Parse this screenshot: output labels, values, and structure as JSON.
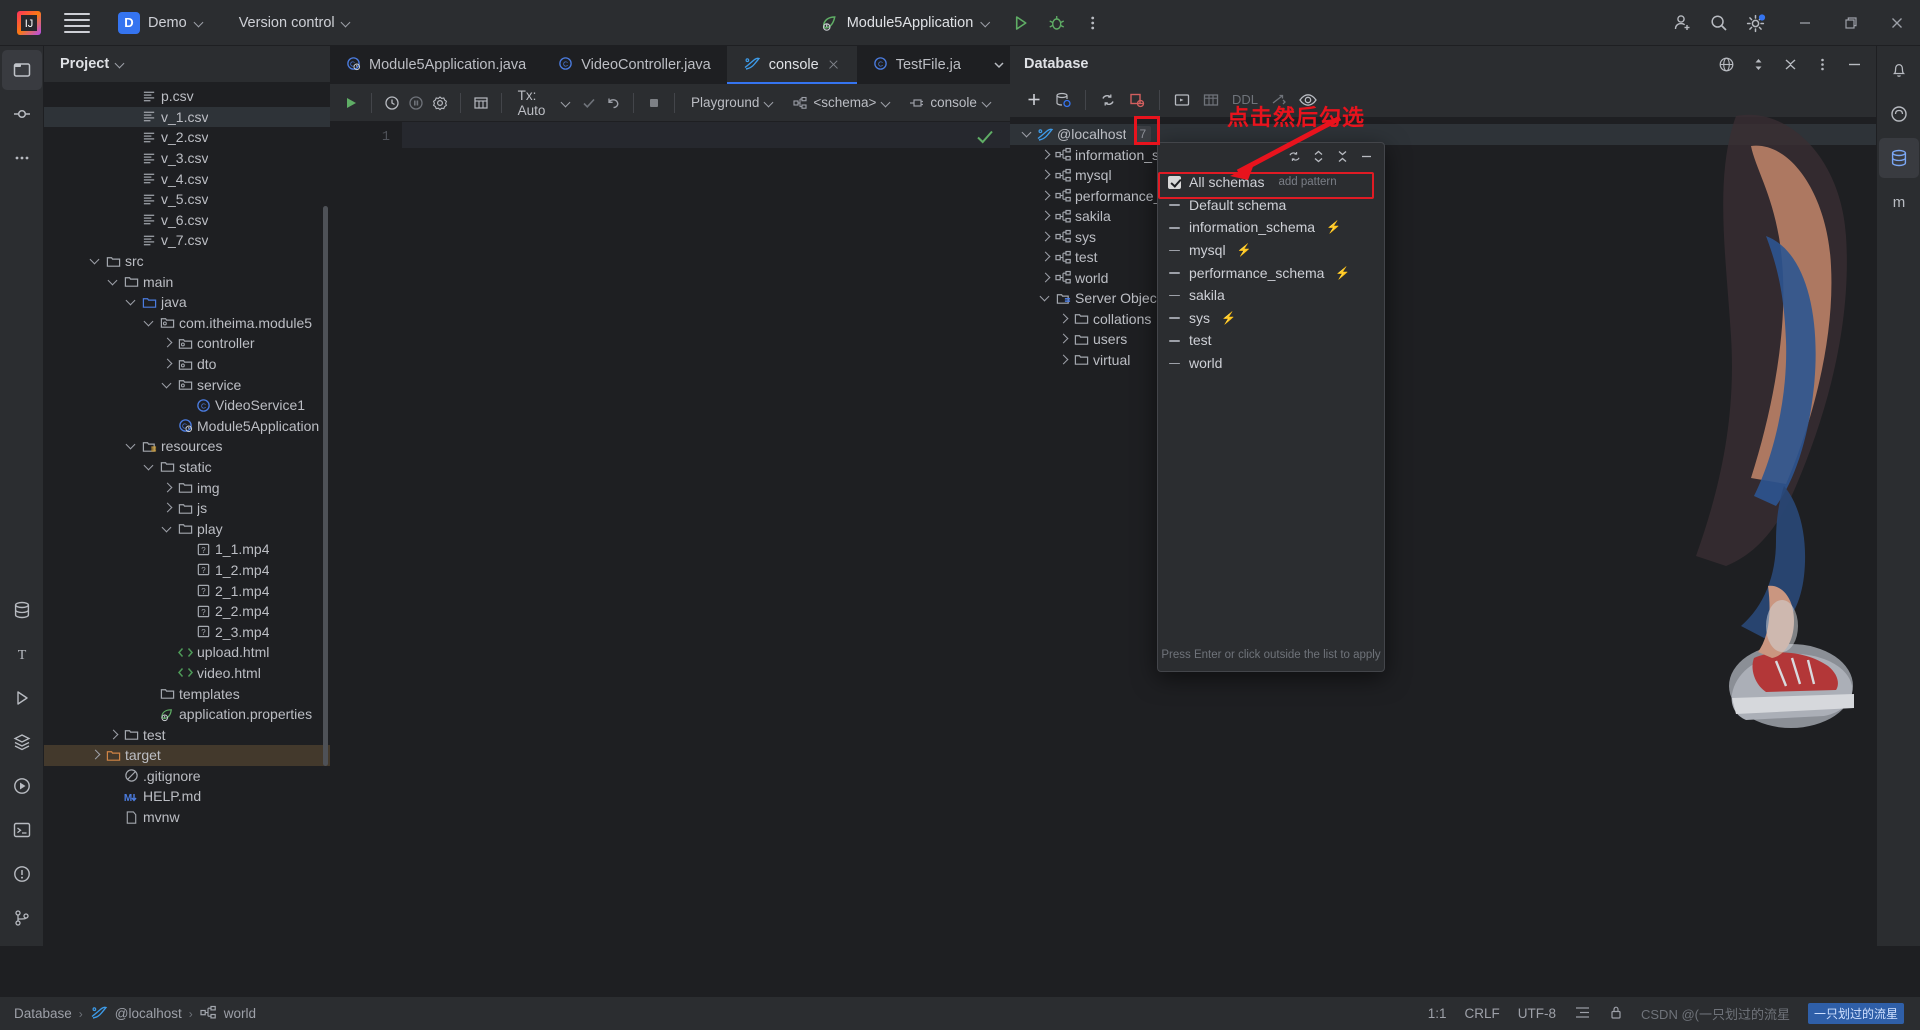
{
  "titlebar": {
    "project_name": "Demo",
    "vcs_label": "Version control",
    "run_config": "Module5Application",
    "icons": {
      "menu": "hamburger-icon",
      "run": "run-icon",
      "debug": "debug-icon",
      "more": "more-vertical-icon",
      "account": "account-icon",
      "search": "search-icon",
      "settings": "settings-icon",
      "minimize": "minimize-icon",
      "maximize": "maximize-icon",
      "close": "close-icon"
    }
  },
  "project_panel": {
    "title": "Project",
    "tree": [
      {
        "label": "p.csv",
        "indent": 4,
        "arrow": "none",
        "icon": "csv",
        "state": ""
      },
      {
        "label": "v_1.csv",
        "indent": 4,
        "arrow": "none",
        "icon": "csv",
        "state": "selected"
      },
      {
        "label": "v_2.csv",
        "indent": 4,
        "arrow": "none",
        "icon": "csv",
        "state": ""
      },
      {
        "label": "v_3.csv",
        "indent": 4,
        "arrow": "none",
        "icon": "csv",
        "state": ""
      },
      {
        "label": "v_4.csv",
        "indent": 4,
        "arrow": "none",
        "icon": "csv",
        "state": ""
      },
      {
        "label": "v_5.csv",
        "indent": 4,
        "arrow": "none",
        "icon": "csv",
        "state": ""
      },
      {
        "label": "v_6.csv",
        "indent": 4,
        "arrow": "none",
        "icon": "csv",
        "state": ""
      },
      {
        "label": "v_7.csv",
        "indent": 4,
        "arrow": "none",
        "icon": "csv",
        "state": ""
      },
      {
        "label": "src",
        "indent": 2,
        "arrow": "down",
        "icon": "folder",
        "state": ""
      },
      {
        "label": "main",
        "indent": 3,
        "arrow": "down",
        "icon": "folder",
        "state": ""
      },
      {
        "label": "java",
        "indent": 4,
        "arrow": "down",
        "icon": "folder-src",
        "state": ""
      },
      {
        "label": "com.itheima.module5",
        "indent": 5,
        "arrow": "down",
        "icon": "package",
        "state": ""
      },
      {
        "label": "controller",
        "indent": 6,
        "arrow": "right",
        "icon": "package",
        "state": ""
      },
      {
        "label": "dto",
        "indent": 6,
        "arrow": "right",
        "icon": "package",
        "state": ""
      },
      {
        "label": "service",
        "indent": 6,
        "arrow": "down",
        "icon": "package",
        "state": ""
      },
      {
        "label": "VideoService1",
        "indent": 7,
        "arrow": "none",
        "icon": "class",
        "state": ""
      },
      {
        "label": "Module5Application",
        "indent": 6,
        "arrow": "none",
        "icon": "spring-class",
        "state": ""
      },
      {
        "label": "resources",
        "indent": 4,
        "arrow": "down",
        "icon": "folder-res",
        "state": ""
      },
      {
        "label": "static",
        "indent": 5,
        "arrow": "down",
        "icon": "folder",
        "state": ""
      },
      {
        "label": "img",
        "indent": 6,
        "arrow": "right",
        "icon": "folder",
        "state": ""
      },
      {
        "label": "js",
        "indent": 6,
        "arrow": "right",
        "icon": "folder",
        "state": ""
      },
      {
        "label": "play",
        "indent": 6,
        "arrow": "down",
        "icon": "folder",
        "state": ""
      },
      {
        "label": "1_1.mp4",
        "indent": 7,
        "arrow": "none",
        "icon": "unknown",
        "state": ""
      },
      {
        "label": "1_2.mp4",
        "indent": 7,
        "arrow": "none",
        "icon": "unknown",
        "state": ""
      },
      {
        "label": "2_1.mp4",
        "indent": 7,
        "arrow": "none",
        "icon": "unknown",
        "state": ""
      },
      {
        "label": "2_2.mp4",
        "indent": 7,
        "arrow": "none",
        "icon": "unknown",
        "state": ""
      },
      {
        "label": "2_3.mp4",
        "indent": 7,
        "arrow": "none",
        "icon": "unknown",
        "state": ""
      },
      {
        "label": "upload.html",
        "indent": 6,
        "arrow": "none",
        "icon": "html",
        "state": ""
      },
      {
        "label": "video.html",
        "indent": 6,
        "arrow": "none",
        "icon": "html",
        "state": ""
      },
      {
        "label": "templates",
        "indent": 5,
        "arrow": "none",
        "icon": "folder",
        "state": ""
      },
      {
        "label": "application.properties",
        "indent": 5,
        "arrow": "none",
        "icon": "spring-prop",
        "state": ""
      },
      {
        "label": "test",
        "indent": 3,
        "arrow": "right",
        "icon": "folder",
        "state": ""
      },
      {
        "label": "target",
        "indent": 2,
        "arrow": "right",
        "icon": "folder-target",
        "state": "target"
      },
      {
        "label": ".gitignore",
        "indent": 3,
        "arrow": "none",
        "icon": "ignore",
        "state": ""
      },
      {
        "label": "HELP.md",
        "indent": 3,
        "arrow": "none",
        "icon": "markdown",
        "state": ""
      },
      {
        "label": "mvnw",
        "indent": 3,
        "arrow": "none",
        "icon": "file",
        "state": ""
      }
    ]
  },
  "editor": {
    "tabs": [
      {
        "label": "Module5Application.java",
        "icon": "spring-class-icon",
        "active": false,
        "closable": false
      },
      {
        "label": "VideoController.java",
        "icon": "class-icon",
        "active": false,
        "closable": false
      },
      {
        "label": "console",
        "icon": "mysql-icon",
        "active": true,
        "closable": true
      },
      {
        "label": "TestFile.ja",
        "icon": "class-icon",
        "active": false,
        "closable": false
      }
    ],
    "tab_actions": {
      "dropdown": "chevron-down-icon",
      "more": "more-vertical-icon"
    },
    "toolbar": {
      "run": "run-icon",
      "history": "history-icon",
      "pause": "pause-icon",
      "settings": "gear-icon",
      "table": "table-icon",
      "tx_label": "Tx: Auto",
      "commit": "commit-icon",
      "rollback": "rollback-icon",
      "stop": "stop-icon",
      "playground": "Playground",
      "schema": "<schema>",
      "session": "console"
    },
    "gutter_line": "1",
    "code_text": ""
  },
  "database": {
    "title": "Database",
    "toolbar": {
      "add": "plus-icon",
      "datasource": "datasource-icon",
      "refresh": "refresh-icon",
      "disconnect": "disconnect-icon",
      "console_icon": "console-icon",
      "table_icon": "table-icon",
      "ddl_label": "DDL",
      "jump": "jump-icon",
      "eye": "eye-icon",
      "filter": "filter-icon",
      "expand": "expand-icon",
      "collapse": "collapse-icon",
      "hide": "hide-icon"
    },
    "header_actions": {
      "globe": "globe-icon",
      "sort": "sort-icon",
      "collapse_all": "collapse-all-icon",
      "options": "more-vertical-icon",
      "minimize": "minimize-icon"
    },
    "tree": [
      {
        "label": "@localhost",
        "badge": "7",
        "indent": 0,
        "arrow": "down",
        "icon": "mysql",
        "state": "selected"
      },
      {
        "label": "information_schema",
        "indent": 1,
        "arrow": "right",
        "icon": "schema",
        "state": ""
      },
      {
        "label": "mysql",
        "indent": 1,
        "arrow": "right",
        "icon": "schema",
        "state": ""
      },
      {
        "label": "performance_schema",
        "indent": 1,
        "arrow": "right",
        "icon": "schema",
        "state": ""
      },
      {
        "label": "sakila",
        "indent": 1,
        "arrow": "right",
        "icon": "schema",
        "state": ""
      },
      {
        "label": "sys",
        "indent": 1,
        "arrow": "right",
        "icon": "schema",
        "state": ""
      },
      {
        "label": "test",
        "indent": 1,
        "arrow": "right",
        "icon": "schema",
        "state": ""
      },
      {
        "label": "world",
        "indent": 1,
        "arrow": "right",
        "icon": "schema",
        "state": ""
      },
      {
        "label": "Server Objects",
        "indent": 1,
        "arrow": "down",
        "icon": "server-objects",
        "state": ""
      },
      {
        "label": "collations",
        "indent": 2,
        "arrow": "right",
        "icon": "folder",
        "state": ""
      },
      {
        "label": "users",
        "indent": 2,
        "arrow": "right",
        "icon": "folder",
        "state": ""
      },
      {
        "label": "virtual",
        "indent": 2,
        "arrow": "right",
        "icon": "folder",
        "state": ""
      }
    ]
  },
  "schema_popup": {
    "items": [
      {
        "label": "All schemas",
        "marker": "checked",
        "hint": "add pattern",
        "bolt": false
      },
      {
        "label": "Default schema",
        "marker": "dash",
        "hint": "",
        "bolt": false
      },
      {
        "label": "information_schema",
        "marker": "dash",
        "hint": "",
        "bolt": true
      },
      {
        "label": "mysql",
        "marker": "dash",
        "hint": "",
        "bolt": true
      },
      {
        "label": "performance_schema",
        "marker": "dash",
        "hint": "",
        "bolt": true
      },
      {
        "label": "sakila",
        "marker": "dash",
        "hint": "",
        "bolt": false
      },
      {
        "label": "sys",
        "marker": "dash",
        "hint": "",
        "bolt": true
      },
      {
        "label": "test",
        "marker": "dash",
        "hint": "",
        "bolt": false
      },
      {
        "label": "world",
        "marker": "dash",
        "hint": "",
        "bolt": false
      }
    ],
    "footer_hint": "Press Enter or click outside the list to apply",
    "toolbar": {
      "refresh": "refresh-icon",
      "expand": "expand-collapse-icon",
      "collapse": "collapse-all-icon",
      "hide": "hide-icon"
    }
  },
  "annotation": {
    "text": "点击然后勾选",
    "color": "#e8131d"
  },
  "statusbar": {
    "breadcrumb": [
      {
        "label": "Database",
        "icon": ""
      },
      {
        "label": "@localhost",
        "icon": "mysql-icon"
      },
      {
        "label": "world",
        "icon": "schema-icon"
      }
    ],
    "caret": "1:1",
    "line_sep": "CRLF",
    "encoding": "UTF-8",
    "indent_icon": "indent-icon",
    "lock_icon": "lock-icon",
    "watermark": "CSDN @(一只划过的流星",
    "watermark_badge": "一只划过的流星"
  },
  "colors": {
    "accent": "#3574f0",
    "panel_bg": "#2b2d30",
    "editor_bg": "#1e1f22",
    "text": "#bcbec4",
    "green": "#5fad65",
    "annotation_red": "#e8131d"
  }
}
